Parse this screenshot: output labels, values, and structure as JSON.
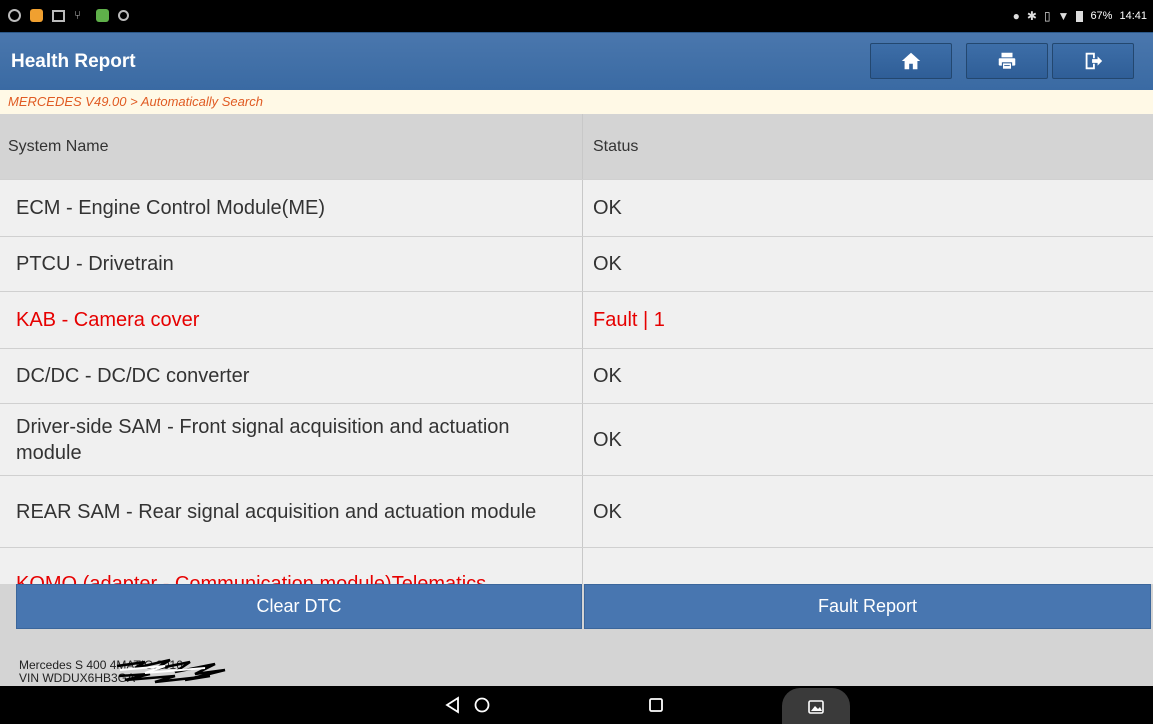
{
  "status_bar": {
    "battery": "67%",
    "time": "14:41"
  },
  "header": {
    "title": "Health Report",
    "icons": [
      "home-icon",
      "print-icon",
      "exit-icon"
    ]
  },
  "breadcrumb": "MERCEDES V49.00 > Automatically Search",
  "table": {
    "columns": [
      "System Name",
      "Status"
    ],
    "rows": [
      {
        "name": "ECM - Engine Control Module(ME)",
        "status": "OK"
      },
      {
        "name": "PTCU - Drivetrain",
        "status": "OK"
      },
      {
        "name": "KAB - Camera cover",
        "status": "Fault | 1"
      },
      {
        "name": "DC/DC - DC/DC converter",
        "status": "OK"
      },
      {
        "name": "Driver-side SAM - Front signal acquisition and actuation module",
        "status": "OK"
      },
      {
        "name": "REAR SAM - Rear signal acquisition and actuation module",
        "status": "OK"
      },
      {
        "name": "KOMO (adapter - Communication module)Telematics",
        "status": ""
      }
    ]
  },
  "buttons": {
    "clear_dtc": "Clear DTC",
    "fault_report": "Fault Report"
  },
  "footer": {
    "vehicle": "Mercedes S 400 4MATIC 2016",
    "vin": "VIN WDDUX6HB3GA"
  },
  "colors": {
    "header_blue": "#3d6ea8",
    "fault_red": "#e60000",
    "breadcrumb_orange": "#e05b23"
  }
}
